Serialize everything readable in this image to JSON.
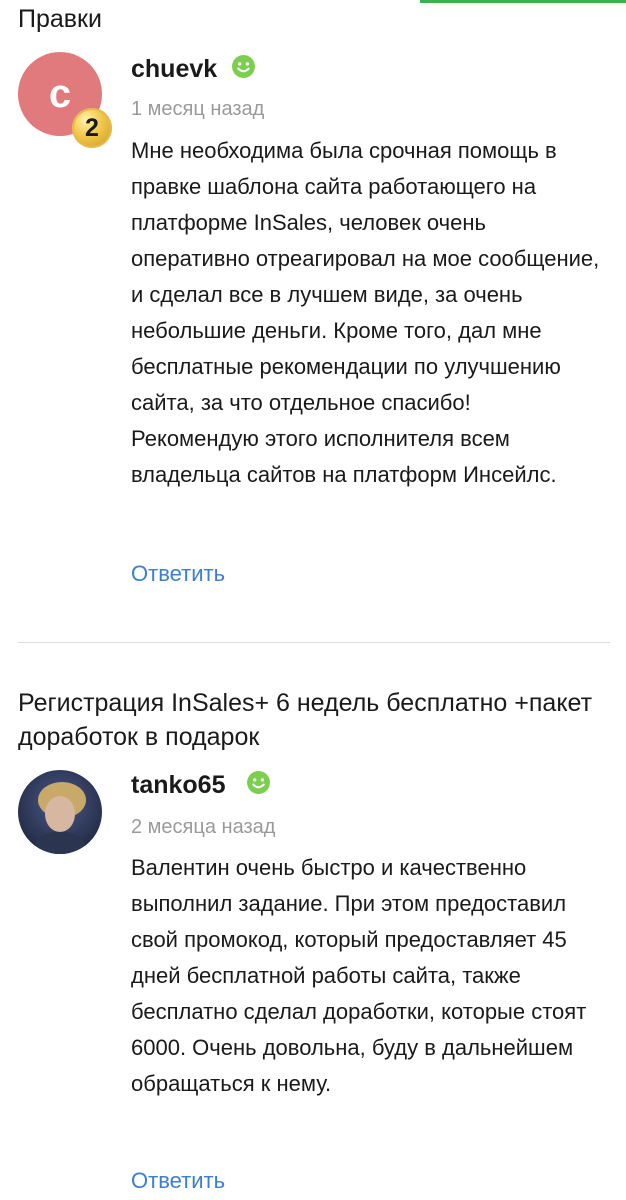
{
  "colors": {
    "accent_green": "#3cb24a",
    "link_blue": "#3c7ed3",
    "avatar_bg": "#e07a7d",
    "badge_gold": "#f2c94c",
    "muted_text": "#9a9a9a",
    "divider": "#dcdcdc"
  },
  "reviews": [
    {
      "service_title": "Правки",
      "avatar": {
        "type": "letter",
        "letter": "c",
        "level_badge": "2"
      },
      "username": "chuevk",
      "status_icon": "smile-icon",
      "timestamp": "1 месяц назад",
      "text": "Мне необходима была срочная помощь в правке шаблона сайта работающего на платформе InSales, человек очень оперативно отреагировал на мое сообщение, и сделал все в лучшем виде, за очень небольшие деньги. Кроме того, дал мне бесплатные рекомендации по улучшению сайта, за что отдельное спасибо! Рекомендую этого исполнителя всем владельца сайтов на платформ Инсейлс.",
      "reply_label": "Ответить"
    },
    {
      "service_title": "Регистрация InSales+ 6 недель бесплатно +пакет доработок в подарок",
      "avatar": {
        "type": "photo"
      },
      "username": "tanko65",
      "status_icon": "smile-icon",
      "timestamp": "2 месяца назад",
      "text": "Валентин очень быстро и качественно выполнил задание. При этом предоставил свой промокод, который предоставляет 45 дней бесплатной работы сайта, также бесплатно сделал доработки, которые стоят 6000. Очень довольна, буду в дальнейшем обращаться к нему.",
      "reply_label": "Ответить"
    }
  ]
}
